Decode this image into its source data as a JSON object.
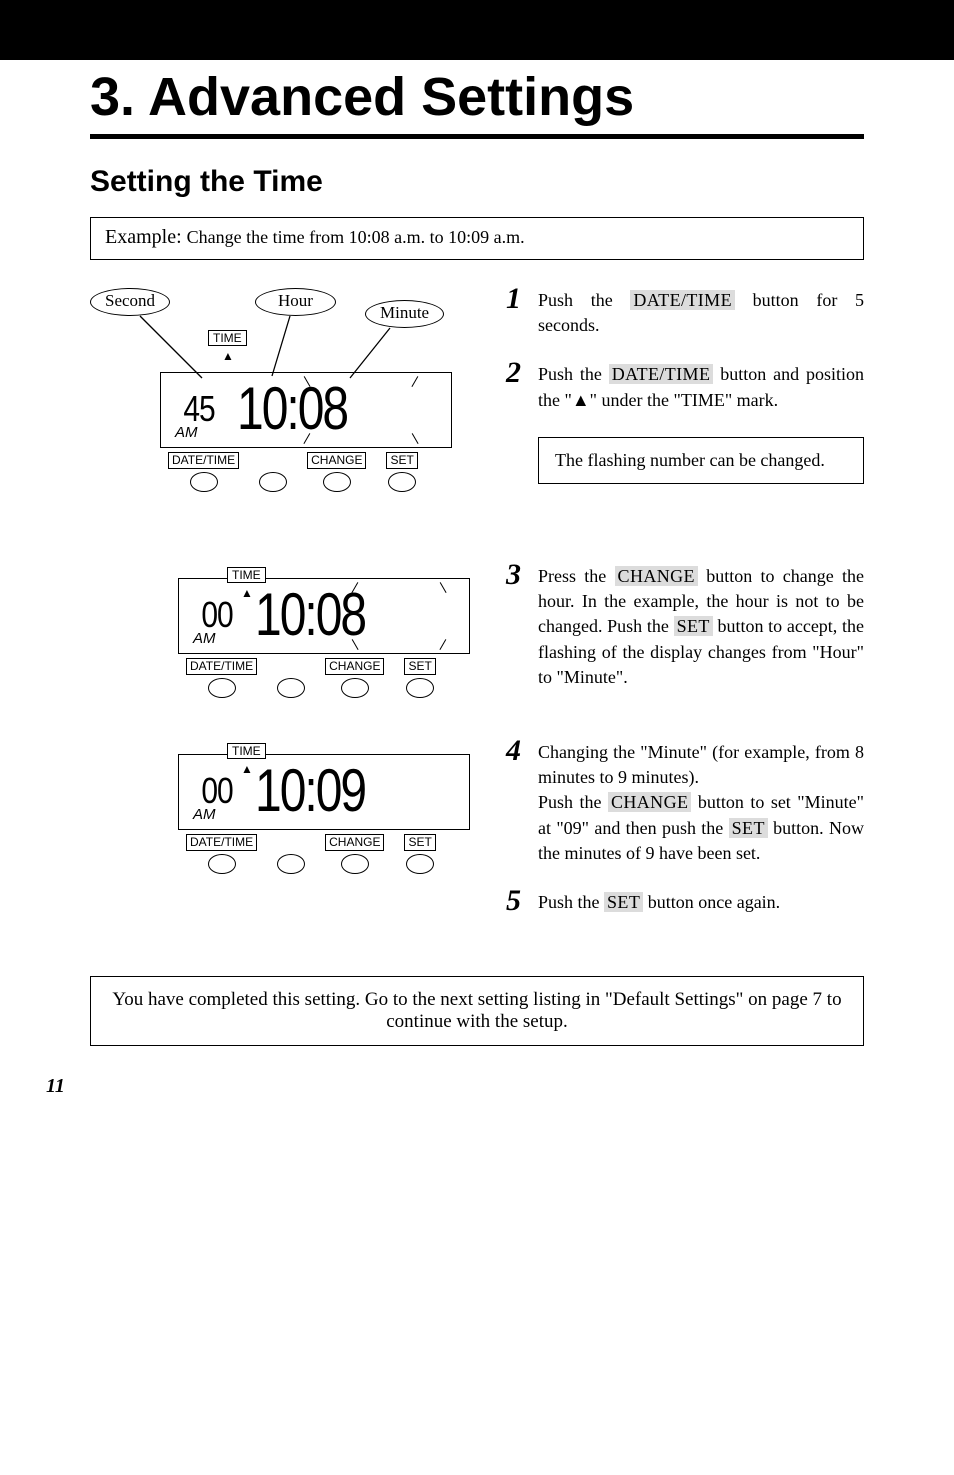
{
  "header": {
    "chapter_title": "3. Advanced Settings",
    "subtitle": "Setting the Time"
  },
  "example": {
    "lead": "Example: ",
    "body": "Change the time from 10:08 a.m. to 10:09 a.m."
  },
  "callouts": {
    "second": "Second",
    "hour": "Hour",
    "minute": "Minute"
  },
  "lcd": {
    "time_label": "TIME",
    "ampm": "AM",
    "pointer": "▲",
    "fig1": {
      "seconds": "45",
      "clock": "10:08"
    },
    "fig2": {
      "seconds": "00",
      "clock": "10:08"
    },
    "fig3": {
      "seconds": "00",
      "clock": "10:09"
    },
    "buttons": {
      "date_time": "DATE/TIME",
      "change": "CHANGE",
      "set": "SET"
    }
  },
  "steps": {
    "s1": {
      "num": "1",
      "pre": "Push the ",
      "btn": "DATE/TIME",
      "post": " button for 5 seconds."
    },
    "s2": {
      "num": "2",
      "pre": "Push the ",
      "btn": "DATE/TIME",
      "post": " button and position the \"",
      "glyph": "▲",
      "post2": "\" under the \"TIME\" mark."
    },
    "note": "The flashing number can be changed.",
    "s3": {
      "num": "3",
      "pre": "Press the ",
      "btn1": "CHANGE",
      "mid": " button to change the hour.  In the example, the hour is not to be changed.  Push the ",
      "btn2": "SET",
      "post": " button to accept, the flashing of the display changes from \"Hour\" to \"Minute\"."
    },
    "s4": {
      "num": "4",
      "l1": "Changing the \"Minute\" (for example, from 8 minutes to 9 minutes).",
      "l2a": "Push the ",
      "btn1": "CHANGE",
      "l2b": " button to set \"Minute\" at \"09\" and then push the ",
      "btn2": "SET",
      "l2c": " button. Now the minutes of 9 have been set."
    },
    "s5": {
      "num": "5",
      "pre": "Push the ",
      "btn": "SET",
      "post": " button once again."
    }
  },
  "conclusion": "You have completed this setting.  Go to the next setting listing in \"Default Settings\" on page 7 to continue with the setup.",
  "page_number": "11"
}
